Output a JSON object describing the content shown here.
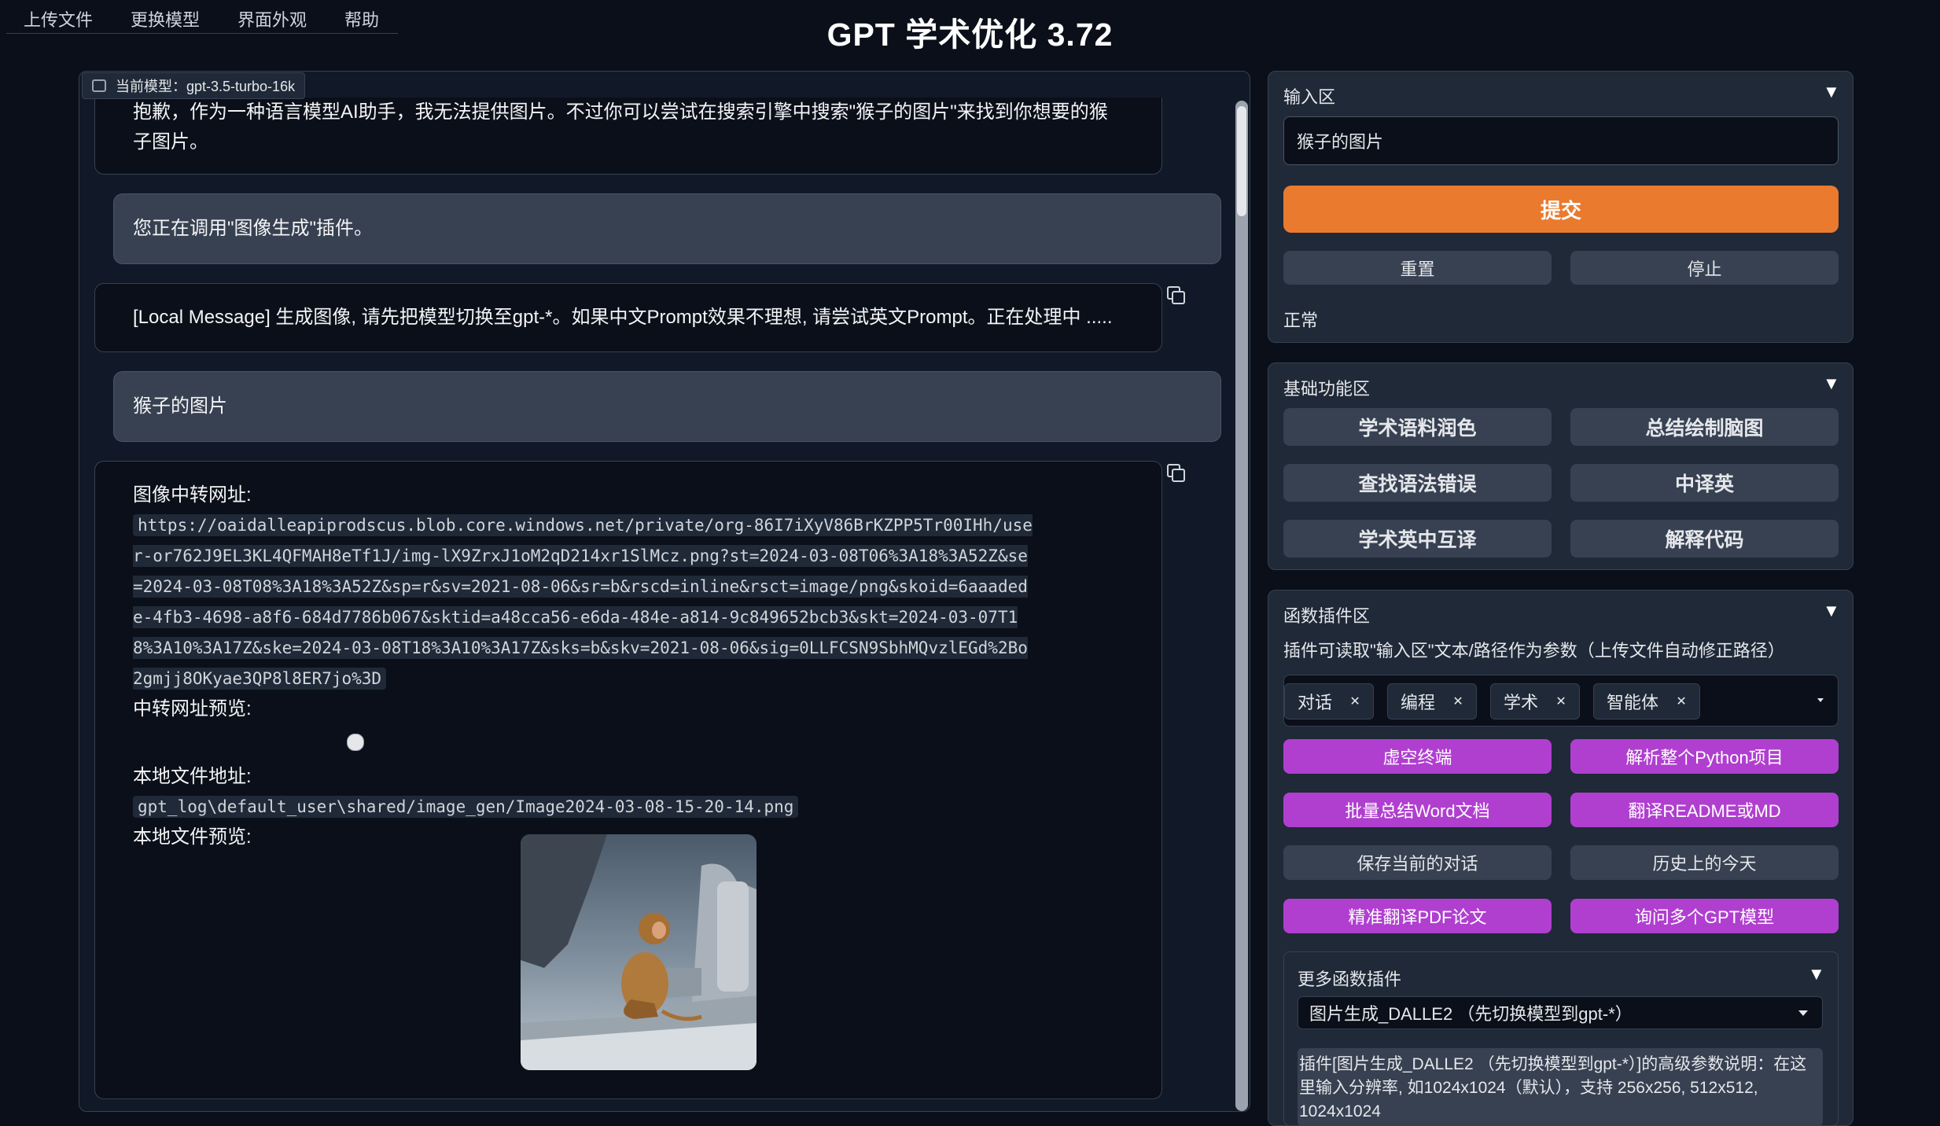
{
  "menu": [
    "上传文件",
    "更换模型",
    "界面外观",
    "帮助"
  ],
  "app_title": "GPT 学术优化 3.72",
  "model_tag": "当前模型：gpt-3.5-turbo-16k",
  "chat": {
    "msg1": "抱歉，作为一种语言模型AI助手，我无法提供图片。不过你可以尝试在搜索引擎中搜索\"猴子的图片\"来找到你想要的猴子图片。",
    "msg2": "您正在调用\"图像生成\"插件。",
    "msg3": "[Local Message] 生成图像, 请先把模型切换至gpt-*。如果中文Prompt效果不理想, 请尝试英文Prompt。正在处理中 .....",
    "msg4": "猴子的图片",
    "result": {
      "label_url": "图像中转网址:",
      "url": "https://oaidalleapiprodscus.blob.core.windows.net/private/org-86I7iXyV86BrKZPP5Tr00IHh/user-or762J9EL3KL4QFMAH8eTf1J/img-lX9ZrxJ1oM2qD214xr1SlMcz.png?st=2024-03-08T06%3A18%3A52Z&se=2024-03-08T08%3A18%3A52Z&sp=r&sv=2021-08-06&sr=b&rscd=inline&rsct=image/png&skoid=6aaadede-4fb3-4698-a8f6-684d7786b067&sktid=a48cca56-e6da-484e-a814-9c849652bcb3&skt=2024-03-07T18%3A10%3A17Z&ske=2024-03-08T18%3A10%3A17Z&sks=b&skv=2021-08-06&sig=0LLFCSN9SbhMQvzlEGd%2Bo2gmjj8OKyae3QP8l8ER7jo%3D",
      "label_preview": "中转网址预览:",
      "label_local": "本地文件地址:",
      "local_path": "gpt_log\\default_user\\shared/image_gen/Image2024-03-08-15-20-14.png",
      "label_local_preview": "本地文件预览:"
    }
  },
  "input_panel": {
    "title": "输入区",
    "input_value": "猴子的图片",
    "submit": "提交",
    "reset": "重置",
    "stop": "停止",
    "status": "正常"
  },
  "basic_panel": {
    "title": "基础功能区",
    "buttons": [
      "学术语料润色",
      "总结绘制脑图",
      "查找语法错误",
      "中译英",
      "学术英中互译",
      "解释代码"
    ]
  },
  "plugin_panel": {
    "title": "函数插件区",
    "desc": "插件可读取\"输入区\"文本/路径作为参数（上传文件自动修正路径）",
    "chips": [
      "对话",
      "编程",
      "学术",
      "智能体"
    ],
    "buttons": [
      "虚空终端",
      "解析整个Python项目",
      "批量总结Word文档",
      "翻译README或MD",
      "保存当前的对话",
      "历史上的今天",
      "精准翻译PDF论文",
      "询问多个GPT模型"
    ],
    "more_title": "更多函数插件",
    "more_selected": "图片生成_DALLE2 （先切换模型到gpt-*）",
    "hint": "插件[图片生成_DALLE2 （先切换模型到gpt-*）]的高级参数说明：在这里输入分辨率, 如1024x1024（默认），支持 256x256, 512x512, 1024x1024"
  },
  "colors": {
    "accent": "#ea7a2e",
    "purple": "#b03fd0",
    "bg": "#0b0f19",
    "panel": "#1f2937"
  }
}
